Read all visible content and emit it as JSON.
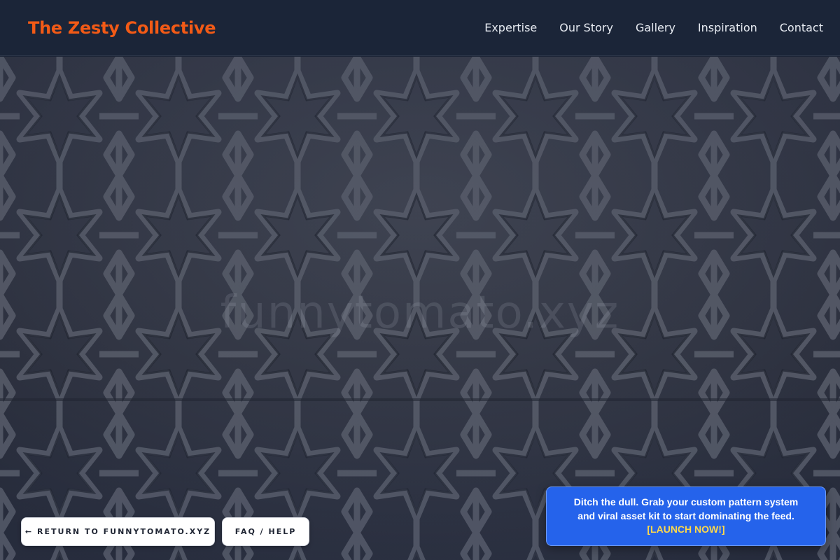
{
  "header": {
    "brand": "The Zesty Collective",
    "nav": [
      "Expertise",
      "Our Story",
      "Gallery",
      "Inspiration",
      "Contact"
    ]
  },
  "hero": {
    "watermark": "funnytomato.xyz"
  },
  "buttons": {
    "return_label": "RETURN TO FUNNYTOMATO.XYZ",
    "return_arrow": "←",
    "faq_label": "FAQ / HELP"
  },
  "cta": {
    "text": "Ditch the dull. Grab your custom pattern system and viral asset kit to start dominating the feed.",
    "link": "[LAUNCH NOW!]"
  },
  "colors": {
    "brand": "#f25a16",
    "header_bg": "#1b2538",
    "cta_bg": "#2563eb",
    "cta_link": "#ffd94a"
  },
  "icons": {
    "return_icon": "left-arrow-icon"
  }
}
